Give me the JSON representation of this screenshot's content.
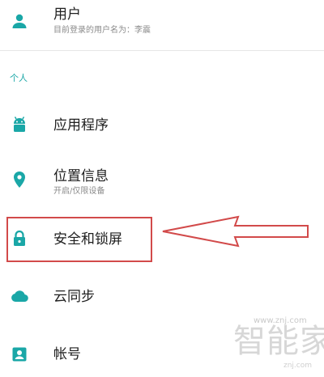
{
  "user": {
    "title": "用户",
    "subtitle": "目前登录的用户名为：李震"
  },
  "section_personal": "个人",
  "items": [
    {
      "label": "应用程序",
      "subtitle": "",
      "icon": "android-icon"
    },
    {
      "label": "位置信息",
      "subtitle": "开启/仅限设备",
      "icon": "location-pin-icon"
    },
    {
      "label": "安全和锁屏",
      "subtitle": "",
      "icon": "lock-icon"
    },
    {
      "label": "云同步",
      "subtitle": "",
      "icon": "cloud-icon"
    },
    {
      "label": "帐号",
      "subtitle": "",
      "icon": "account-icon"
    }
  ],
  "watermark": {
    "small": "www.znj.com",
    "big": "智能家",
    "url": "znj.com"
  },
  "colors": {
    "accent": "#1aa7a7",
    "annotation": "#d24a4a"
  }
}
